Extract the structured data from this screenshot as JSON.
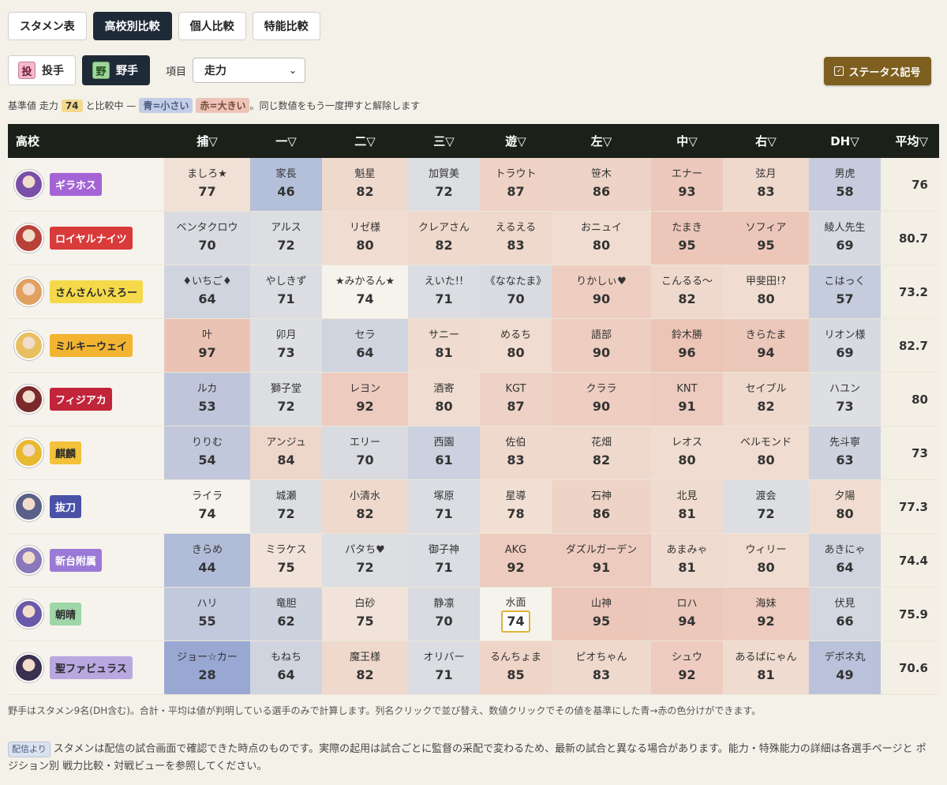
{
  "tabs": [
    "スタメン表",
    "高校別比較",
    "個人比較",
    "特能比較"
  ],
  "active_tab": 1,
  "mode": {
    "pitcher_icon": "投",
    "pitcher_label": "投手",
    "fielder_icon": "野",
    "fielder_label": "野手",
    "item_label": "項目",
    "select_value": "走力"
  },
  "status_button": "ステータス記号",
  "info": {
    "prefix": "基準値 走力",
    "base_value": "74",
    "middle": "と比較中 —",
    "blue": "青=小さい",
    "red": "赤=大きい",
    "suffix": "。同じ数値をもう一度押すと解除します"
  },
  "headers": [
    "高校",
    "捕▽",
    "一▽",
    "二▽",
    "三▽",
    "遊▽",
    "左▽",
    "中▽",
    "右▽",
    "DH▽",
    "平均▽"
  ],
  "base": 74,
  "rows": [
    {
      "school": "ギラホス",
      "badge_color": "#a464d6",
      "avatar_color": "#7a4fa8",
      "cells": [
        [
          "ましろ★",
          77
        ],
        [
          "家長",
          46
        ],
        [
          "魁星",
          82
        ],
        [
          "加賀美",
          72
        ],
        [
          "トラウト",
          87
        ],
        [
          "笹木",
          86
        ],
        [
          "エナー",
          93
        ],
        [
          "弦月",
          83
        ],
        [
          "男虎",
          58
        ]
      ],
      "avg": "76"
    },
    {
      "school": "ロイヤルナイツ",
      "badge_color": "#d93a3a",
      "avatar_color": "#b8423a",
      "cells": [
        [
          "ベンタクロウ",
          70
        ],
        [
          "アルス",
          72
        ],
        [
          "リゼ様",
          80
        ],
        [
          "クレアさん",
          82
        ],
        [
          "えるえる",
          83
        ],
        [
          "おニュイ",
          80
        ],
        [
          "たまき",
          95
        ],
        [
          "ソフィア",
          95
        ],
        [
          "綾人先生",
          69
        ]
      ],
      "avg": "80.7"
    },
    {
      "school": "さんさんいえろー",
      "badge_color": "#f5d94a",
      "badge_text_dark": true,
      "avatar_color": "#e0a060",
      "cells": [
        [
          "♦いちご♦",
          64
        ],
        [
          "やしきず",
          71
        ],
        [
          "★みかるん★",
          74
        ],
        [
          "えいた!!",
          71
        ],
        [
          "《ななたま》",
          70
        ],
        [
          "りかしぃ♥",
          90
        ],
        [
          "こんるる〜",
          82
        ],
        [
          "甲斐田!?",
          80
        ],
        [
          "こはっく",
          57
        ]
      ],
      "avg": "73.2"
    },
    {
      "school": "ミルキーウェイ",
      "badge_color": "#f3b531",
      "badge_text_dark": true,
      "avatar_color": "#e8c060",
      "cells": [
        [
          "叶",
          97
        ],
        [
          "卯月",
          73
        ],
        [
          "セラ",
          64
        ],
        [
          "サニー",
          81
        ],
        [
          "めるち",
          80
        ],
        [
          "語部",
          90
        ],
        [
          "鈴木勝",
          96
        ],
        [
          "きらたま",
          94
        ],
        [
          "リオン様",
          69
        ]
      ],
      "avg": "82.7"
    },
    {
      "school": "フィジアカ",
      "badge_color": "#c2243a",
      "avatar_color": "#7a2a2a",
      "cells": [
        [
          "ルカ",
          53
        ],
        [
          "獅子堂",
          72
        ],
        [
          "レヨン",
          92
        ],
        [
          "酒寄",
          80
        ],
        [
          "KGT",
          87
        ],
        [
          "クララ",
          90
        ],
        [
          "KNT",
          91
        ],
        [
          "セイブル",
          82
        ],
        [
          "ハユン",
          73
        ]
      ],
      "avg": "80"
    },
    {
      "school": "麒麟",
      "badge_color": "#f3c13a",
      "badge_text_dark": true,
      "avatar_color": "#e8b830",
      "cells": [
        [
          "りりむ",
          54
        ],
        [
          "アンジュ",
          84
        ],
        [
          "エリー",
          70
        ],
        [
          "西園",
          61
        ],
        [
          "佐伯",
          83
        ],
        [
          "花畑",
          82
        ],
        [
          "レオス",
          80
        ],
        [
          "ベルモンド",
          80
        ],
        [
          "先斗寧",
          63
        ]
      ],
      "avg": "73"
    },
    {
      "school": "抜刀",
      "badge_color": "#4a52a8",
      "avatar_color": "#5a6088",
      "cells": [
        [
          "ライラ",
          74
        ],
        [
          "城瀬",
          72
        ],
        [
          "小清水",
          82
        ],
        [
          "塚原",
          71
        ],
        [
          "星導",
          78
        ],
        [
          "石神",
          86
        ],
        [
          "北見",
          81
        ],
        [
          "渡会",
          72
        ],
        [
          "夕陽",
          80
        ]
      ],
      "avg": "77.3"
    },
    {
      "school": "新台附属",
      "badge_color": "#9a7ad6",
      "avatar_color": "#8a78b8",
      "cells": [
        [
          "きらめ",
          44
        ],
        [
          "ミラケス",
          75
        ],
        [
          "パタち♥",
          72
        ],
        [
          "御子神",
          71
        ],
        [
          "AKG",
          92
        ],
        [
          "ダズルガーデン",
          91
        ],
        [
          "あまみゃ",
          81
        ],
        [
          "ウィリー",
          80
        ],
        [
          "あきにゃ",
          64
        ]
      ],
      "avg": "74.4"
    },
    {
      "school": "朝晴",
      "badge_color": "#9ed6a8",
      "badge_text_dark": true,
      "avatar_color": "#6a58a8",
      "cells": [
        [
          "ハリ",
          55
        ],
        [
          "竜胆",
          62
        ],
        [
          "白砂",
          75
        ],
        [
          "静凛",
          70
        ],
        [
          "水面",
          74
        ],
        [
          "山神",
          95
        ],
        [
          "ロハ",
          94
        ],
        [
          "海妹",
          92
        ],
        [
          "伏見",
          66
        ]
      ],
      "avg": "75.9"
    },
    {
      "school": "聖ファビュラス",
      "badge_color": "#b8a8e0",
      "badge_text_dark": true,
      "avatar_color": "#3a3050",
      "cells": [
        [
          "ジョー☆カー",
          28
        ],
        [
          "もねち",
          64
        ],
        [
          "魔王様",
          82
        ],
        [
          "オリバー",
          71
        ],
        [
          "るんちょま",
          85
        ],
        [
          "ピオちゃん",
          83
        ],
        [
          "シュウ",
          92
        ],
        [
          "あるばにゃん",
          81
        ],
        [
          "デボネ丸",
          49
        ]
      ],
      "avg": "70.6"
    }
  ],
  "marked": {
    "row": 8,
    "col": 4
  },
  "footer_note": "野手はスタメン9名(DH含む)。合計・平均は値が判明している選手のみで計算します。列名クリックで並び替え、数値クリックでその値を基準にした青→赤の色分けができます。",
  "footer_tag": "配信より",
  "footer_text": "スタメンは配信の試合画面で確認できた時点のものです。実際の起用は試合ごとに監督の采配で変わるため、最新の試合と異なる場合があります。能力・特殊能力の詳細は各選手ページと ポジション別 戦力比較・対戦ビューを参照してください。"
}
